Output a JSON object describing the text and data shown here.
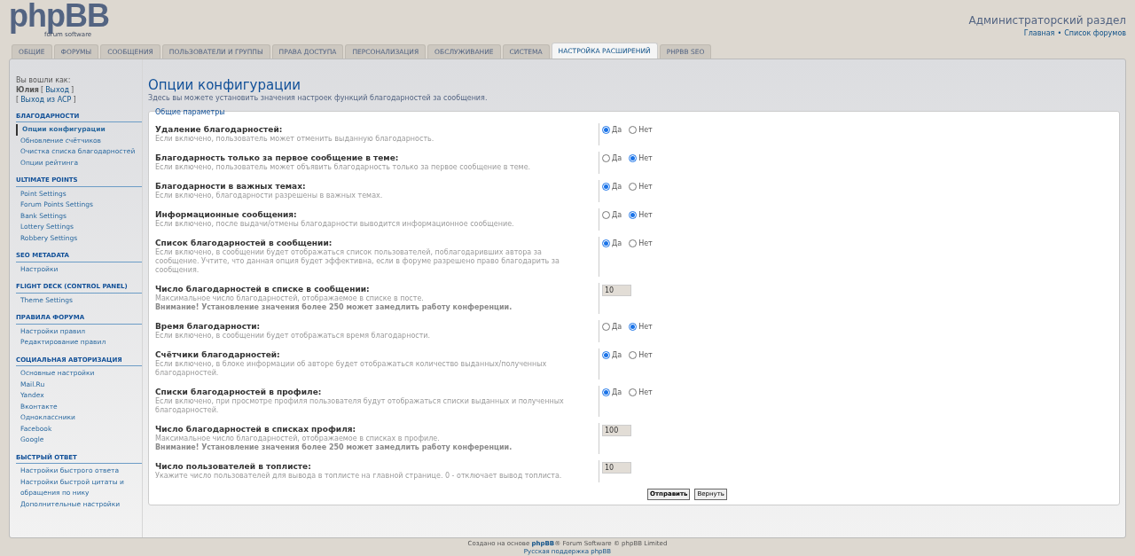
{
  "logo": {
    "name": "phpBB",
    "tagline": "forum software"
  },
  "header": {
    "title": "Администраторский раздел",
    "links": [
      "Главная",
      "Список форумов"
    ],
    "separator": "•"
  },
  "tabs": [
    {
      "label": "ОБЩИЕ",
      "selected": false
    },
    {
      "label": "ФОРУМЫ",
      "selected": false
    },
    {
      "label": "СООБЩЕНИЯ",
      "selected": false
    },
    {
      "label": "ПОЛЬЗОВАТЕЛИ И ГРУППЫ",
      "selected": false
    },
    {
      "label": "ПРАВА ДОСТУПА",
      "selected": false
    },
    {
      "label": "ПЕРСОНАЛИЗАЦИЯ",
      "selected": false
    },
    {
      "label": "ОБСЛУЖИВАНИЕ",
      "selected": false
    },
    {
      "label": "СИСТЕМА",
      "selected": false
    },
    {
      "label": "НАСТРОЙКА РАСШИРЕНИЙ",
      "selected": true
    },
    {
      "label": "PHPBB SEO",
      "selected": false
    }
  ],
  "user": {
    "label": "Вы вошли как:",
    "name": "Юлия",
    "logout": "Выход",
    "acp_logout": "Выход из ACP",
    "bracket_open": "[",
    "bracket_close": "]"
  },
  "sidebar": [
    {
      "title": "БЛАГОДАРНОСТИ",
      "items": [
        {
          "label": "Опции конфигурации",
          "selected": true
        },
        {
          "label": "Обновление счётчиков",
          "selected": false
        },
        {
          "label": "Очистка списка благодарностей",
          "selected": false
        },
        {
          "label": "Опции рейтинга",
          "selected": false
        }
      ]
    },
    {
      "title": "ULTIMATE POINTS",
      "items": [
        {
          "label": "Point Settings",
          "selected": false
        },
        {
          "label": "Forum Points Settings",
          "selected": false
        },
        {
          "label": "Bank Settings",
          "selected": false
        },
        {
          "label": "Lottery Settings",
          "selected": false
        },
        {
          "label": "Robbery Settings",
          "selected": false
        }
      ]
    },
    {
      "title": "SEO METADATA",
      "items": [
        {
          "label": "Настройки",
          "selected": false
        }
      ]
    },
    {
      "title": "FLIGHT DECK (CONTROL PANEL)",
      "items": [
        {
          "label": "Theme Settings",
          "selected": false
        }
      ]
    },
    {
      "title": "ПРАВИЛА ФОРУМА",
      "items": [
        {
          "label": "Настройки правил",
          "selected": false
        },
        {
          "label": "Редактирование правил",
          "selected": false
        }
      ]
    },
    {
      "title": "СОЦИАЛЬНАЯ АВТОРИЗАЦИЯ",
      "items": [
        {
          "label": "Основные настройки",
          "selected": false
        },
        {
          "label": "Mail.Ru",
          "selected": false
        },
        {
          "label": "Yandex",
          "selected": false
        },
        {
          "label": "Вконтакте",
          "selected": false
        },
        {
          "label": "Одноклассники",
          "selected": false
        },
        {
          "label": "Facebook",
          "selected": false
        },
        {
          "label": "Google",
          "selected": false
        }
      ]
    },
    {
      "title": "БЫСТРЫЙ ОТВЕТ",
      "items": [
        {
          "label": "Настройки быстрого ответа",
          "selected": false
        },
        {
          "label": "Настройки быстрой цитаты и обращения по нику",
          "selected": false
        },
        {
          "label": "Дополнительные настройки",
          "selected": false
        }
      ]
    }
  ],
  "page": {
    "title": "Опции конфигурации",
    "description": "Здесь вы можете установить значения настроек функций благодарностей за сообщения."
  },
  "fieldset": {
    "legend": "Общие параметры",
    "settings": [
      {
        "kind": "radio",
        "label": "Удаление благодарностей:",
        "description": "Если включено, пользователь может отменить выданную благодарность.",
        "options": [
          {
            "label": "Да",
            "selected": true
          },
          {
            "label": "Нет",
            "selected": false
          }
        ]
      },
      {
        "kind": "radio",
        "label": "Благодарность только за первое сообщение в теме:",
        "description": "Если включено, пользователь может объявить благодарность только за первое сообщение в теме.",
        "options": [
          {
            "label": "Да",
            "selected": false
          },
          {
            "label": "Нет",
            "selected": true
          }
        ]
      },
      {
        "kind": "radio",
        "label": "Благодарности в важных темах:",
        "description": "Если включено, благодарности разрешены в важных темах.",
        "options": [
          {
            "label": "Да",
            "selected": true
          },
          {
            "label": "Нет",
            "selected": false
          }
        ]
      },
      {
        "kind": "radio",
        "label": "Информационные сообщения:",
        "description": "Если включено, после выдачи/отмены благодарности выводится информационное сообщение.",
        "options": [
          {
            "label": "Да",
            "selected": false
          },
          {
            "label": "Нет",
            "selected": true
          }
        ]
      },
      {
        "kind": "radio",
        "label": "Список благодарностей в сообщении:",
        "description": "Если включено, в сообщении будет отображаться список пользователей, поблагодаривших автора за сообщение. Учтите, что данная опция будет эффективна, если в форуме разрешено право благодарить за сообщения.",
        "options": [
          {
            "label": "Да",
            "selected": true
          },
          {
            "label": "Нет",
            "selected": false
          }
        ]
      },
      {
        "kind": "number",
        "label": "Число благодарностей в списке в сообщении:",
        "description": "Максимальное число благодарностей, отображаемое в списке в посте.",
        "warning": "Внимание! Установление значения более 250 может замедлить работу конференции.",
        "value": "10"
      },
      {
        "kind": "radio",
        "label": "Время благодарности:",
        "description": "Если включено, в сообщении будет отображаться время благодарности.",
        "options": [
          {
            "label": "Да",
            "selected": false
          },
          {
            "label": "Нет",
            "selected": true
          }
        ]
      },
      {
        "kind": "radio",
        "label": "Счётчики благодарностей:",
        "description": "Если включено, в блоке информации об авторе будет отображаться количество выданных/полученных благодарностей.",
        "options": [
          {
            "label": "Да",
            "selected": true
          },
          {
            "label": "Нет",
            "selected": false
          }
        ]
      },
      {
        "kind": "radio",
        "label": "Списки благодарностей в профиле:",
        "description": "Если включено, при просмотре профиля пользователя будут отображаться списки выданных и полученных благодарностей.",
        "options": [
          {
            "label": "Да",
            "selected": true
          },
          {
            "label": "Нет",
            "selected": false
          }
        ]
      },
      {
        "kind": "number",
        "label": "Число благодарностей в списках профиля:",
        "description": "Максимальное число благодарностей, отображаемое в списках в профиле.",
        "warning": "Внимание! Установление значения более 250 может замедлить работу конференции.",
        "value": "100"
      },
      {
        "kind": "number",
        "label": "Число пользователей в топлисте:",
        "description": "Укажите число пользователей для вывода в топлисте на главной странице. 0 - отключает вывод топлиста.",
        "value": "10"
      }
    ]
  },
  "buttons": [
    {
      "label": "Отправить",
      "kind": "primary"
    },
    {
      "label": "Вернуть",
      "kind": "secondary"
    }
  ],
  "footer": {
    "before": "Создано на основе",
    "link": "phpBB",
    "after": "® Forum Software © phpBB Limited",
    "support": "Русская поддержка phpBB"
  }
}
